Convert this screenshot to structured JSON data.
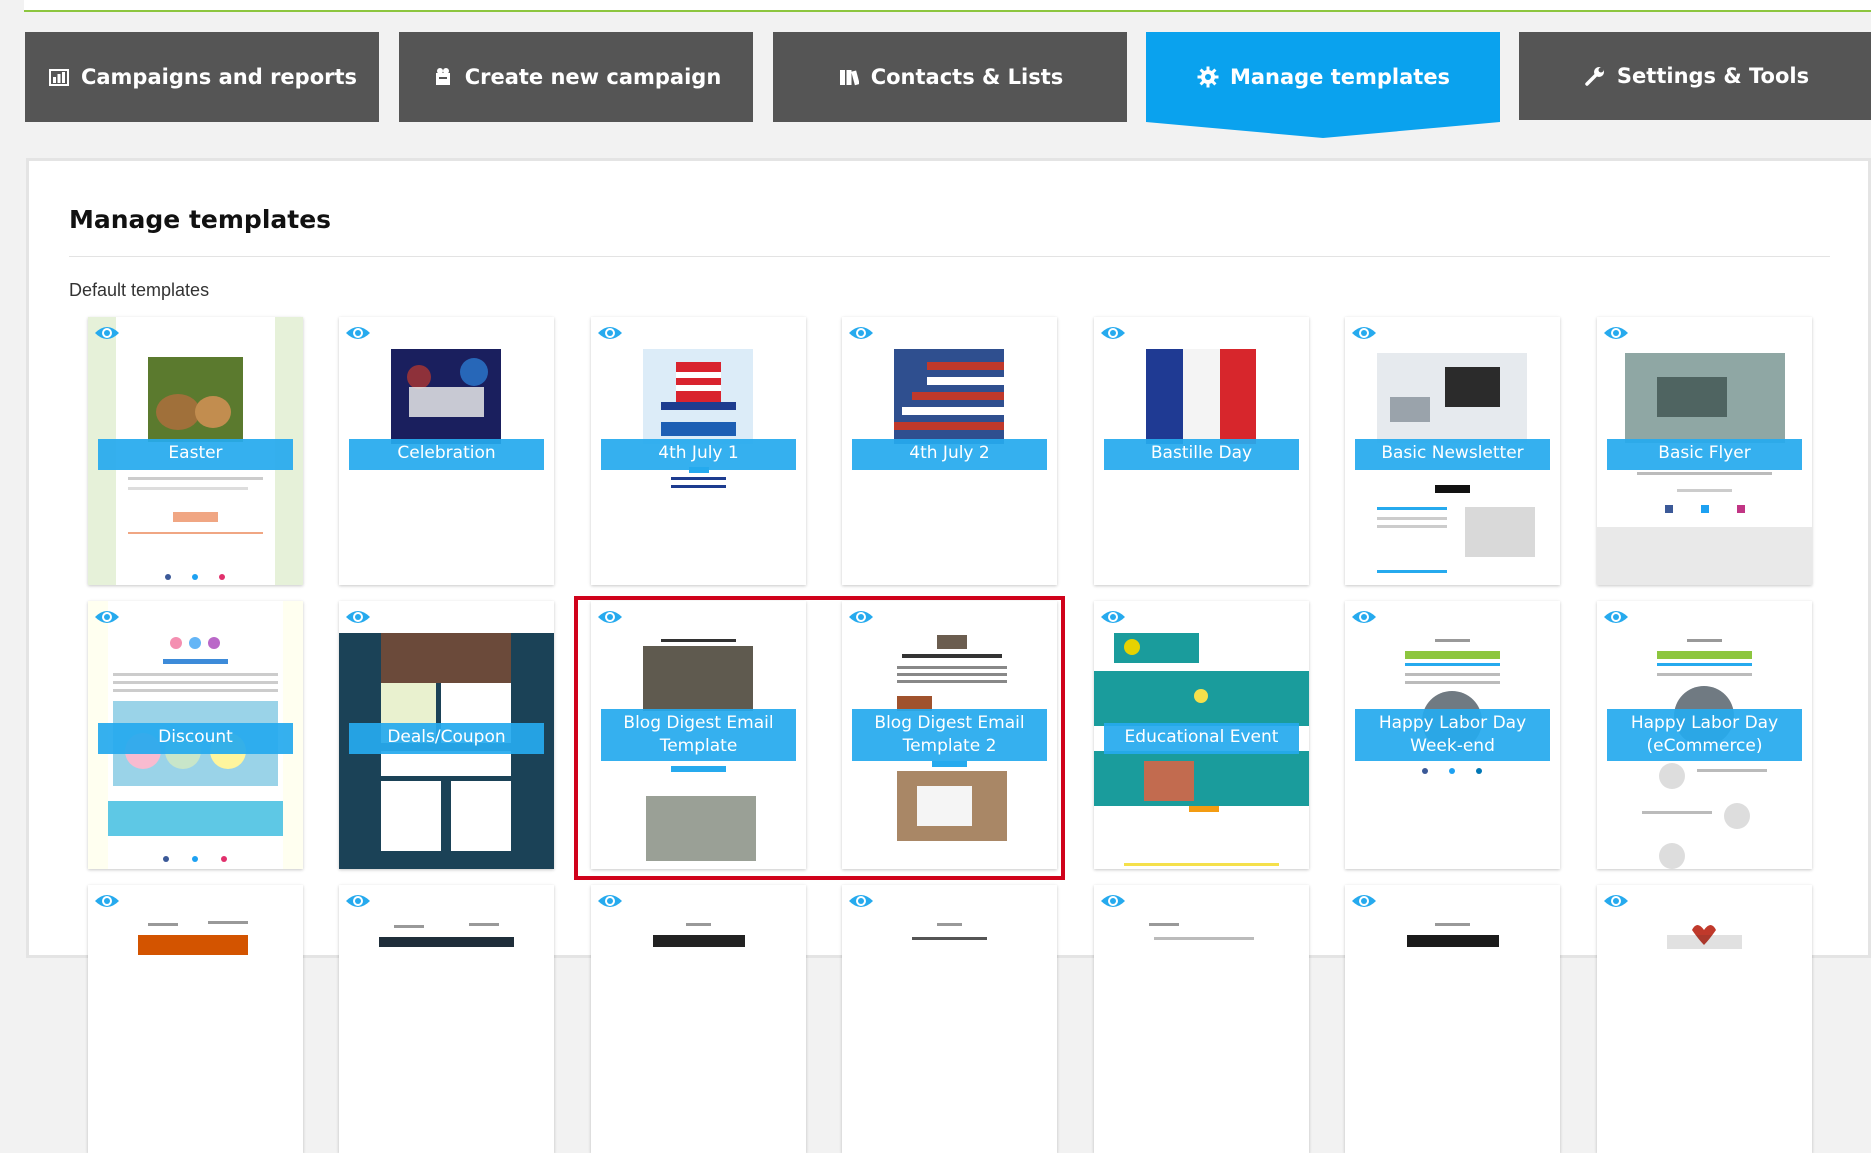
{
  "nav": {
    "tabs": [
      {
        "label": "Campaigns and reports",
        "icon": "report-icon",
        "active": false
      },
      {
        "label": "Create new campaign",
        "icon": "campaign-icon",
        "active": false
      },
      {
        "label": "Contacts & Lists",
        "icon": "contacts-icon",
        "active": false
      },
      {
        "label": "Manage templates",
        "icon": "gear-icon",
        "active": true
      },
      {
        "label": "Settings & Tools",
        "icon": "wrench-icon",
        "active": false
      }
    ]
  },
  "page": {
    "title": "Manage templates",
    "section": "Default templates"
  },
  "templates": [
    {
      "name": "Easter"
    },
    {
      "name": "Celebration"
    },
    {
      "name": "4th July 1"
    },
    {
      "name": "4th July 2"
    },
    {
      "name": "Bastille Day"
    },
    {
      "name": "Basic Newsletter"
    },
    {
      "name": "Basic Flyer"
    },
    {
      "name": "Discount"
    },
    {
      "name": "Deals/Coupon"
    },
    {
      "name": "Blog Digest Email Template"
    },
    {
      "name": "Blog Digest Email Template 2"
    },
    {
      "name": "Educational Event"
    },
    {
      "name": "Happy Labor Day Week-end"
    },
    {
      "name": "Happy Labor Day (eCommerce)"
    }
  ],
  "colors": {
    "accent": "#0aa2ee",
    "tab": "#555555",
    "label_bg": "#26aaee",
    "highlight": "#d0021b"
  }
}
